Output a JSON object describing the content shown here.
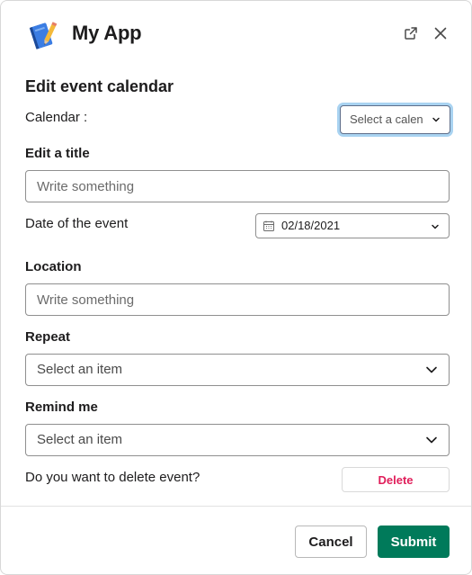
{
  "app": {
    "title": "My App",
    "icon": "notebook-pencil-icon"
  },
  "header": {
    "external_icon": "external-link-icon",
    "close_icon": "close-icon"
  },
  "form": {
    "section_title": "Edit event calendar",
    "calendar": {
      "label": "Calendar :",
      "placeholder": "Select a calendar"
    },
    "title": {
      "label": "Edit a title",
      "placeholder": "Write something"
    },
    "date": {
      "label": "Date of the event",
      "value": "02/18/2021"
    },
    "location": {
      "label": "Location",
      "placeholder": "Write something"
    },
    "repeat": {
      "label": "Repeat",
      "placeholder": "Select an item"
    },
    "remind": {
      "label": "Remind me",
      "placeholder": "Select an item"
    },
    "delete": {
      "question": "Do you want to delete event?",
      "button_label": "Delete"
    }
  },
  "footer": {
    "cancel_label": "Cancel",
    "submit_label": "Submit"
  },
  "colors": {
    "accent": "#007a5a",
    "danger": "#e01e5a",
    "focus": "#a9d3f1"
  }
}
